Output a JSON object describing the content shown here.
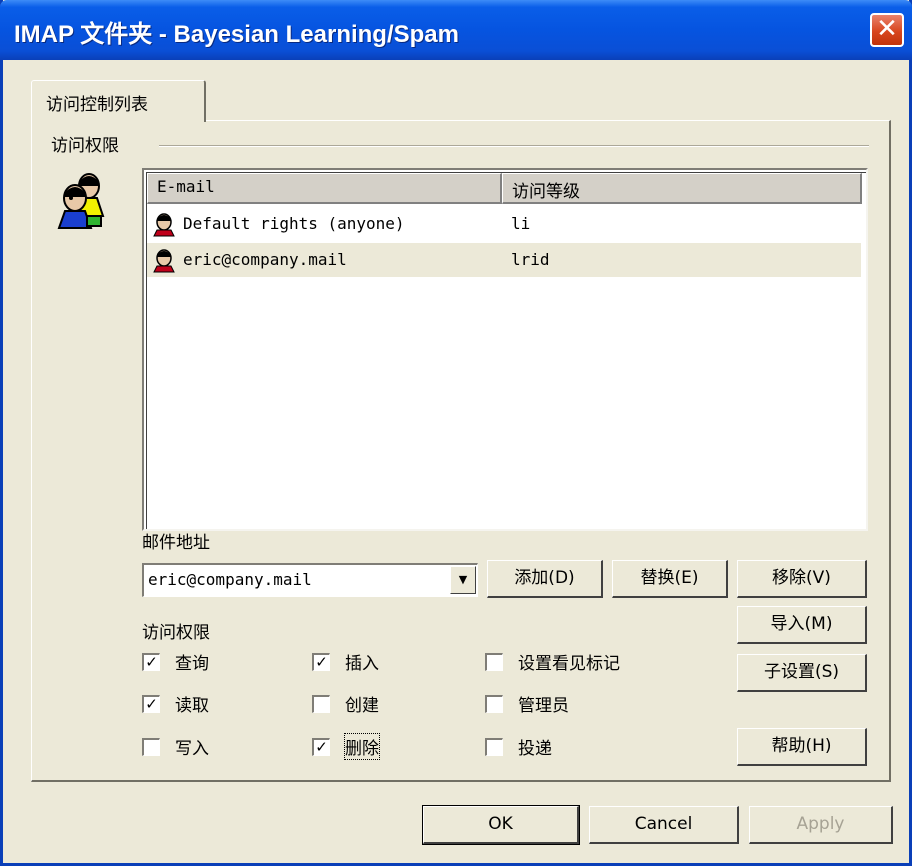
{
  "window": {
    "title": "IMAP 文件夹 - Bayesian Learning/Spam",
    "close_glyph": "✕"
  },
  "tabs": [
    {
      "label": "访问控制列表"
    }
  ],
  "acl": {
    "group_label": "访问权限",
    "icon": "people-icon",
    "columns": [
      "E-mail",
      "访问等级"
    ],
    "rows": [
      {
        "email": "Default rights (anyone)",
        "level": "li",
        "icon": "user-icon",
        "selected": false
      },
      {
        "email": "eric@company.mail",
        "level": "lrid",
        "icon": "user-icon",
        "selected": true
      }
    ]
  },
  "address": {
    "label": "邮件地址",
    "value": "eric@company.mail",
    "arrow_glyph": "▼"
  },
  "buttons": {
    "add": "添加(D)",
    "replace": "替换(E)",
    "remove": "移除(V)",
    "import": "导入(M)",
    "sub_settings": "子设置(S)",
    "help": "帮助(H)",
    "ok": "OK",
    "cancel": "Cancel",
    "apply": "Apply"
  },
  "permissions": {
    "label": "访问权限",
    "check_glyph": "✓",
    "items": [
      {
        "label": "查询",
        "checked": true
      },
      {
        "label": "读取",
        "checked": true
      },
      {
        "label": "写入",
        "checked": false
      },
      {
        "label": "插入",
        "checked": true
      },
      {
        "label": "创建",
        "checked": false
      },
      {
        "label": "删除",
        "checked": true
      },
      {
        "label": "设置看见标记",
        "checked": false
      },
      {
        "label": "管理员",
        "checked": false
      },
      {
        "label": "投递",
        "checked": false
      }
    ]
  }
}
